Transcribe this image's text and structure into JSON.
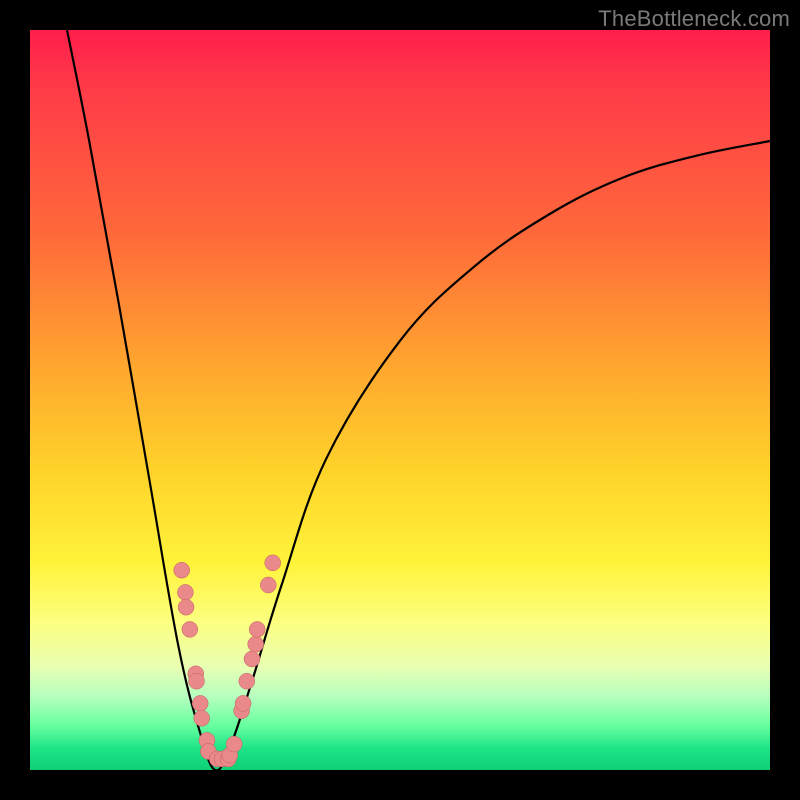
{
  "watermark": "TheBottleneck.com",
  "colors": {
    "background": "#000000",
    "gradient_top": "#ff1e4b",
    "gradient_bottom": "#0ecf74",
    "curve": "#000000",
    "dot_fill": "#e98989",
    "dot_stroke": "#c06060"
  },
  "chart_data": {
    "type": "line",
    "title": "",
    "xlabel": "",
    "ylabel": "",
    "xlim": [
      0,
      100
    ],
    "ylim": [
      0,
      100
    ],
    "grid": false,
    "legend": false,
    "series": [
      {
        "name": "bottleneck-curve",
        "comment": "V-shaped curve; y is approximate proportion of plot height from bottom (0=bottom, 100=top). Minimum near x≈25.",
        "x": [
          5,
          8,
          12,
          16,
          20,
          23,
          25,
          27,
          30,
          34,
          40,
          50,
          60,
          70,
          80,
          90,
          100
        ],
        "y": [
          100,
          85,
          63,
          40,
          17,
          5,
          0,
          3,
          12,
          25,
          42,
          58,
          68,
          75,
          80,
          83,
          85
        ]
      }
    ],
    "dots": {
      "comment": "Salmon clustered points near the valley of the curve, x/y in same 0-100 space as series.",
      "points": [
        {
          "x": 20.5,
          "y": 27
        },
        {
          "x": 21.0,
          "y": 24
        },
        {
          "x": 21.1,
          "y": 22
        },
        {
          "x": 21.6,
          "y": 19
        },
        {
          "x": 22.4,
          "y": 13
        },
        {
          "x": 22.5,
          "y": 12
        },
        {
          "x": 23.0,
          "y": 9
        },
        {
          "x": 23.2,
          "y": 7
        },
        {
          "x": 23.9,
          "y": 4
        },
        {
          "x": 24.1,
          "y": 2.5
        },
        {
          "x": 25.3,
          "y": 1.5
        },
        {
          "x": 26.0,
          "y": 1.5
        },
        {
          "x": 26.8,
          "y": 1.5
        },
        {
          "x": 27.0,
          "y": 2.0
        },
        {
          "x": 27.6,
          "y": 3.5
        },
        {
          "x": 28.6,
          "y": 8
        },
        {
          "x": 28.8,
          "y": 9
        },
        {
          "x": 29.3,
          "y": 12
        },
        {
          "x": 30.0,
          "y": 15
        },
        {
          "x": 30.5,
          "y": 17
        },
        {
          "x": 30.7,
          "y": 19
        },
        {
          "x": 32.2,
          "y": 25
        },
        {
          "x": 32.8,
          "y": 28
        }
      ],
      "radius": 8
    }
  }
}
